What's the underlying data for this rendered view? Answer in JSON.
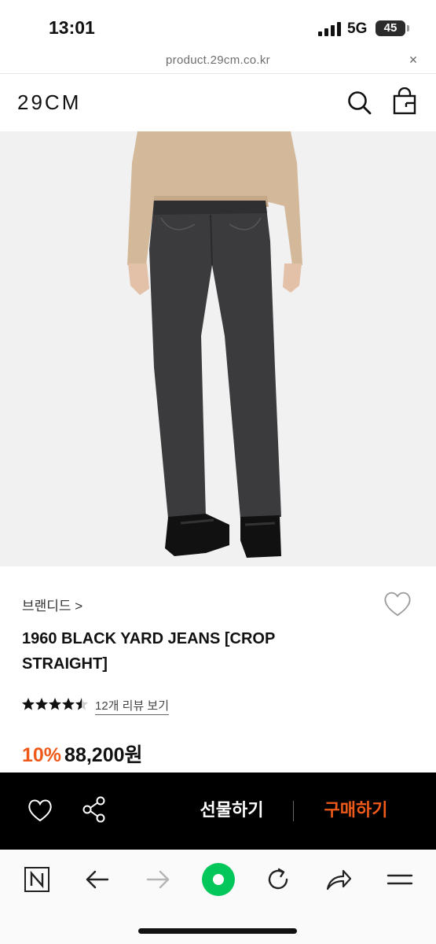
{
  "status_bar": {
    "time": "13:01",
    "network": "5G",
    "battery": "45"
  },
  "url_bar": {
    "url": "product.29cm.co.kr",
    "close_glyph": "×"
  },
  "header": {
    "logo": "29CM",
    "icons": [
      "search-icon",
      "bag-icon"
    ]
  },
  "product": {
    "brand": "브랜디드 >",
    "title": "1960 BLACK YARD JEANS [CROP STRAIGHT]",
    "rating_stars": 4.5,
    "review_link": "12개 리뷰 보기",
    "discount": "10%",
    "price": "88,200원"
  },
  "buy_bar": {
    "gift_label": "선물하기",
    "purchase_label": "구매하기",
    "icons": [
      "heart-icon",
      "share-icon"
    ]
  },
  "browser_toolbar": {
    "icons": [
      "naver-n-icon",
      "back-arrow-icon",
      "forward-arrow-icon",
      "green-home-icon",
      "refresh-icon",
      "share-arrow-icon",
      "menu-icon"
    ]
  },
  "colors": {
    "accent": "#ef5a1a",
    "buy_bar_bg": "#000000",
    "green": "#03c75a",
    "image_bg": "#f1f1f2"
  }
}
